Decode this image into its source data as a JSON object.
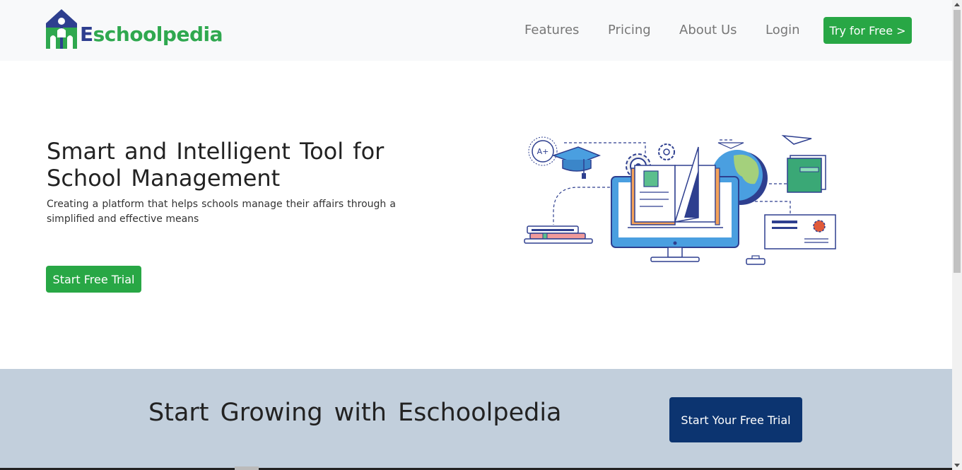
{
  "brand": {
    "logo_first": "E",
    "logo_rest": "schoolpedia",
    "color_green": "#2fa84f",
    "color_navy": "#2e3f8f"
  },
  "nav": {
    "items": [
      {
        "label": "Features"
      },
      {
        "label": "Pricing"
      },
      {
        "label": "About Us"
      },
      {
        "label": "Login"
      }
    ],
    "cta_label": "Try for Free >"
  },
  "hero": {
    "title": "Smart and Intelligent Tool for School Management",
    "subtitle": "Creating a platform that helps schools manage their affairs through a simplified and effective means",
    "button_label": "Start Free Trial",
    "badge_text": "A+"
  },
  "cta_band": {
    "title": "Start Growing with Eschoolpedia",
    "button_label": "Start Your Free Trial",
    "background": "#c2cfdc",
    "button_color": "#0c3470"
  },
  "colors": {
    "accent_green": "#28a745"
  }
}
